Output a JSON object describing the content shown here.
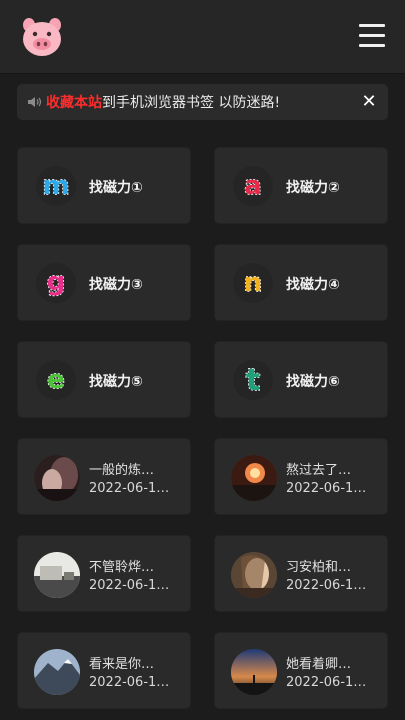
{
  "header": {
    "logo_icon": "pig-face-icon",
    "menu_icon": "hamburger-menu-icon"
  },
  "notice": {
    "highlight": "收藏本站",
    "text": "到手机浏览器书签 以防迷路!",
    "close_label": "✕",
    "highlight_color": "#ff2c2c"
  },
  "magnet_links": [
    {
      "label": "找磁力①",
      "letter": "m",
      "color": "#2ea8e6"
    },
    {
      "label": "找磁力②",
      "letter": "a",
      "color": "#e8294a"
    },
    {
      "label": "找磁力③",
      "letter": "g",
      "color": "#e82f8a"
    },
    {
      "label": "找磁力④",
      "letter": "n",
      "color": "#f0b21e"
    },
    {
      "label": "找磁力⑤",
      "letter": "e",
      "color": "#4cc238"
    },
    {
      "label": "找磁力⑥",
      "letter": "t",
      "color": "#1fa07a"
    }
  ],
  "posts": [
    {
      "title": "一般的炼…",
      "date": "2022-06-1…"
    },
    {
      "title": "熬过去了…",
      "date": "2022-06-1…"
    },
    {
      "title": "不管聆烨…",
      "date": "2022-06-1…"
    },
    {
      "title": "习安柏和…",
      "date": "2022-06-1…"
    },
    {
      "title": "看来是你…",
      "date": "2022-06-1…"
    },
    {
      "title": "她看着卿…",
      "date": "2022-06-1…"
    }
  ]
}
